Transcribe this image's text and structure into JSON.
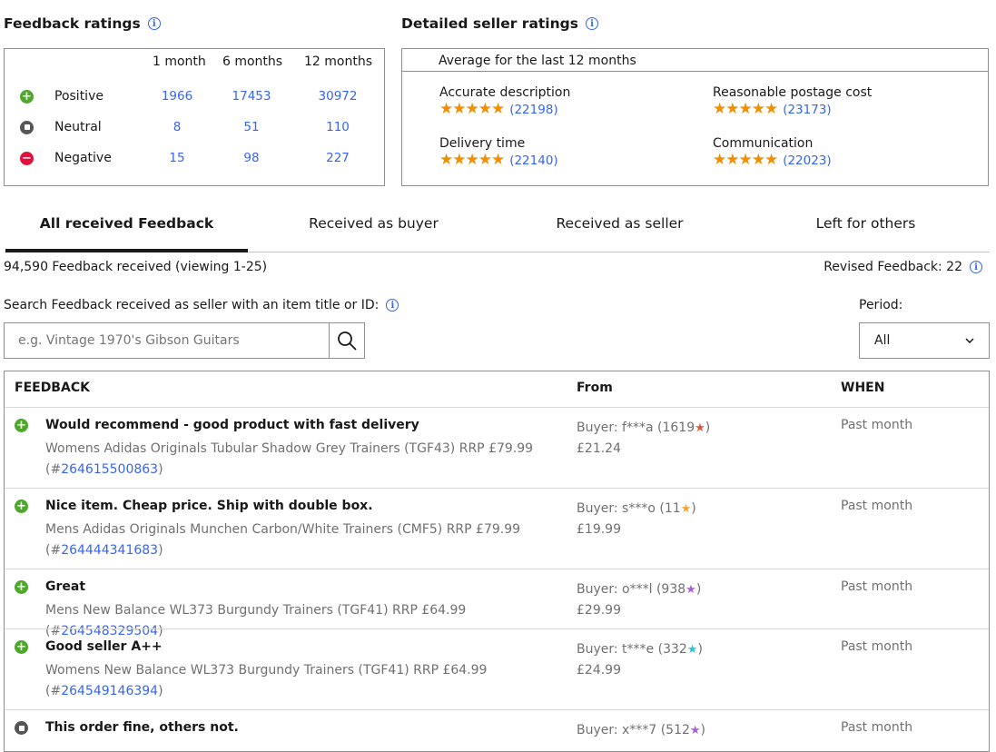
{
  "feedback_ratings": {
    "title": "Feedback ratings",
    "columns": [
      "1 month",
      "6 months",
      "12 months"
    ],
    "rows": [
      {
        "label": "Positive",
        "values": [
          "1966",
          "17453",
          "30972"
        ],
        "type": "positive"
      },
      {
        "label": "Neutral",
        "values": [
          "8",
          "51",
          "110"
        ],
        "type": "neutral"
      },
      {
        "label": "Negative",
        "values": [
          "15",
          "98",
          "227"
        ],
        "type": "negative"
      }
    ]
  },
  "detailed_ratings": {
    "title": "Detailed seller ratings",
    "subtitle": "Average for the last 12 months",
    "items": [
      {
        "label": "Accurate description",
        "count": "(22198)",
        "stars": 5
      },
      {
        "label": "Reasonable postage cost",
        "count": "(23173)",
        "stars": 5
      },
      {
        "label": "Delivery time",
        "count": "(22140)",
        "stars": 5
      },
      {
        "label": "Communication",
        "count": "(22023)",
        "stars": 5
      }
    ]
  },
  "tabs": [
    {
      "label": "All received Feedback",
      "active": true
    },
    {
      "label": "Received as buyer",
      "active": false
    },
    {
      "label": "Received as seller",
      "active": false
    },
    {
      "label": "Left for others",
      "active": false
    }
  ],
  "summary": {
    "count_text": "94,590 Feedback received (viewing 1-25)",
    "revised_text": "Revised Feedback: 22"
  },
  "search": {
    "label": "Search Feedback received as seller with an item title or ID:",
    "placeholder": "e.g. Vintage 1970's Gibson Guitars"
  },
  "period": {
    "label": "Period:",
    "selected": "All"
  },
  "table": {
    "headers": [
      "FEEDBACK",
      "From",
      "WHEN"
    ],
    "rows": [
      {
        "type": "positive",
        "title": "Would recommend - good product with fast delivery",
        "item": "Womens Adidas Originals Tubular Shadow Grey Trainers (TGF43) RRP £79.99",
        "item_id": "264615500863",
        "buyer": "Buyer: f***a (1619",
        "star_color": "#e0533b",
        "price": "£21.24",
        "when": "Past month"
      },
      {
        "type": "positive",
        "title": "Nice item. Cheap price. Ship with double box.",
        "item": "Mens Adidas Originals Munchen Carbon/White Trainers (CMF5) RRP £79.99",
        "item_id": "264444341683",
        "buyer": "Buyer: s***o (11",
        "star_color": "#f5a623",
        "price": "£19.99",
        "when": "Past month"
      },
      {
        "type": "positive",
        "title": "Great",
        "item": "Mens New Balance WL373 Burgundy Trainers (TGF41) RRP £64.99",
        "item_id": "264548329504",
        "buyer": "Buyer: o***l (938",
        "star_color": "#a95ed6",
        "price": "£29.99",
        "when": "Past month"
      },
      {
        "type": "positive",
        "title": "Good seller A++",
        "item": "Womens New Balance WL373 Burgundy Trainers (TGF41) RRP £64.99",
        "item_id": "264549146394",
        "buyer": "Buyer: t***e (332",
        "star_color": "#36c0d6",
        "price": "£24.99",
        "when": "Past month"
      },
      {
        "type": "neutral",
        "title": "This order fine, others not.",
        "item": "",
        "item_id": "",
        "buyer": "Buyer: x***7 (512",
        "star_color": "#a95ed6",
        "price": "",
        "when": "Past month"
      }
    ]
  }
}
